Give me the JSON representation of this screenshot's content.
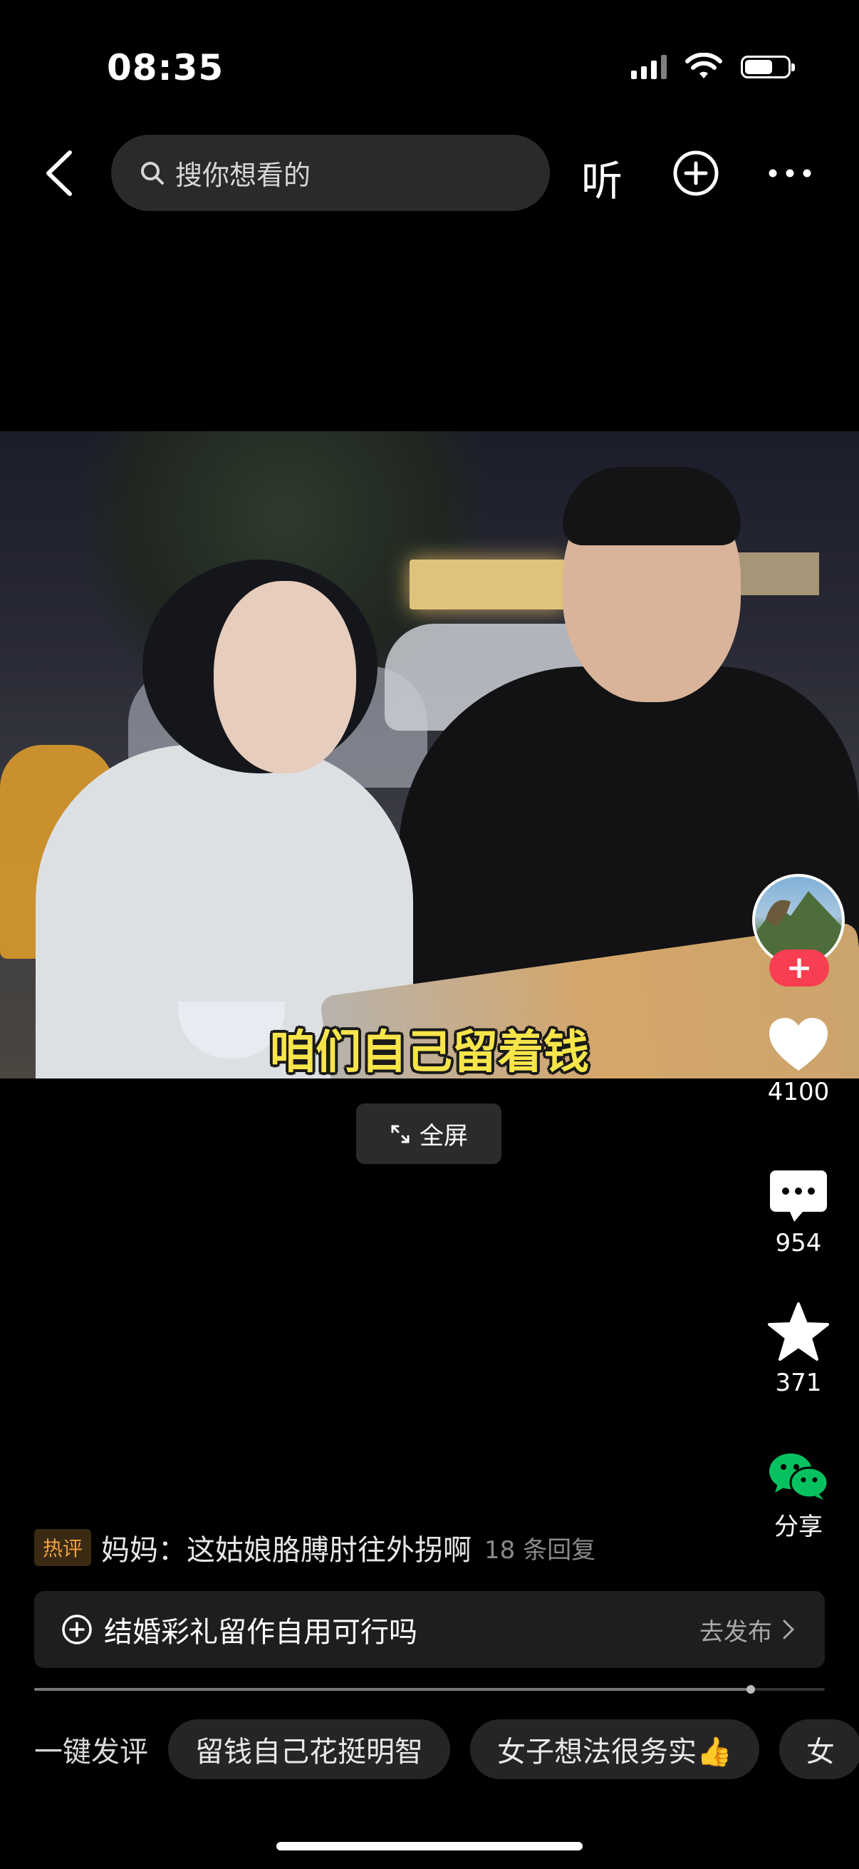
{
  "status_bar": {
    "time": "08:35",
    "battery_level": 0.65
  },
  "top_nav": {
    "search_placeholder": "搜你想看的",
    "listen_label": "听"
  },
  "video": {
    "subtitle": "咱们自己留着钱",
    "fullscreen_label": "全屏"
  },
  "actions": {
    "likes": "4100",
    "comments": "954",
    "favorites": "371",
    "share_label": "分享"
  },
  "hot_comment": {
    "badge": "热评",
    "text": "妈妈：这姑娘胳膊肘往外拐啊",
    "replies": "18 条回复"
  },
  "topic": {
    "text": "结婚彩礼留作自用可行吗",
    "action": "去发布"
  },
  "progress": {
    "value": 0.906
  },
  "quick_comments": {
    "label": "一键发评",
    "chips": [
      "留钱自己花挺明智",
      "女子想法很务实👍",
      "女"
    ]
  },
  "colors": {
    "accent_red": "#fa3e51",
    "wechat_green": "#07c160",
    "hot_orange": "#f2a33a"
  }
}
